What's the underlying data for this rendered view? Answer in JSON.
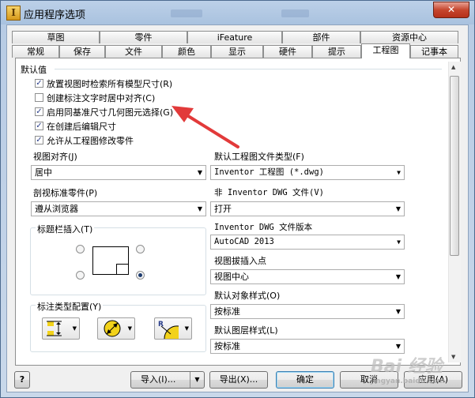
{
  "window": {
    "title": "应用程序选项",
    "close_glyph": "✕"
  },
  "tabs_row1": [
    "草图",
    "零件",
    "iFeature",
    "部件",
    "资源中心"
  ],
  "tabs_row2": [
    "常规",
    "保存",
    "文件",
    "颜色",
    "显示",
    "硬件",
    "提示",
    "工程图",
    "记事本"
  ],
  "active_tab": "工程图",
  "section": {
    "defaults_title": "默认值"
  },
  "checkboxes": [
    {
      "label": "放置视图时检索所有模型尺寸(R)",
      "checked": true
    },
    {
      "label": "创建标注文字时居中对齐(C)",
      "checked": false
    },
    {
      "label": "启用同基准尺寸几何图元选择(G)",
      "checked": true
    },
    {
      "label": "在创建后编辑尺寸",
      "checked": true
    },
    {
      "label": "允许从工程图修改零件",
      "checked": true
    }
  ],
  "left": {
    "view_align_label": "视图对齐(J)",
    "view_align_value": "居中",
    "section_part_label": "剖视标准零件(P)",
    "section_part_value": "遵从浏览器",
    "title_block_label": "标题栏插入(T)",
    "title_block_selected": "bottom-right",
    "dim_type_label": "标注类型配置(Y)"
  },
  "right": {
    "default_file_type_label": "默认工程图文件类型(F)",
    "default_file_type_value": "Inventor 工程图 (*.dwg)",
    "non_dwg_label": "非 Inventor DWG 文件(V)",
    "non_dwg_value": "打开",
    "dwg_version_label": "Inventor DWG 文件版本",
    "dwg_version_value": "AutoCAD 2013",
    "view_insert_label": "视图拔插入点",
    "view_insert_value": "视图中心",
    "object_style_label": "默认对象样式(O)",
    "object_style_value": "按标准",
    "layer_style_label": "默认图层样式(L)",
    "layer_style_value": "按标准"
  },
  "buttons": {
    "help": "?",
    "import": "导入(I)...",
    "export": "导出(X)...",
    "ok": "确定",
    "cancel": "取消",
    "apply": "应用(A)"
  },
  "watermark": {
    "main": "Bai 经验",
    "sub": "jingyan.baidu.com"
  },
  "colors": {
    "annotation_arrow": "#e23a3a",
    "checkmark": "#2b3f8b"
  }
}
